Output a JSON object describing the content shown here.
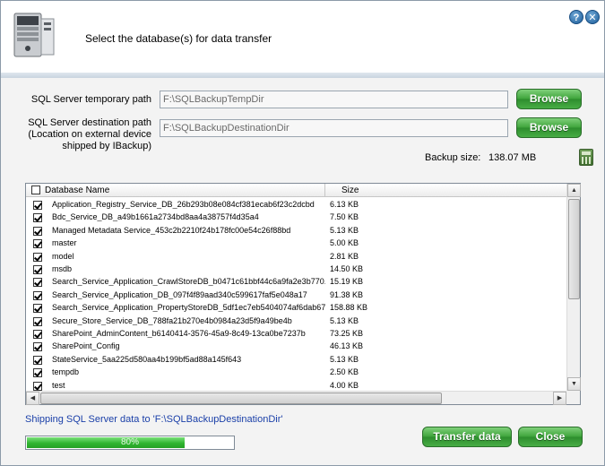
{
  "header": {
    "title": "Select the database(s) for data transfer",
    "help_label": "?",
    "close_label": "✕"
  },
  "paths": {
    "temp_label": "SQL Server temporary path",
    "temp_value": "F:\\SQLBackupTempDir",
    "dest_label_line1": "SQL Server destination path",
    "dest_label_line2": "(Location on external device",
    "dest_label_line3": "shipped by IBackup)",
    "dest_value": "F:\\SQLBackupDestinationDir",
    "browse_label": "Browse"
  },
  "backup": {
    "size_label": "Backup size:",
    "size_value": "138.07 MB"
  },
  "table": {
    "columns": {
      "name": "Database Name",
      "size": "Size"
    },
    "rows": [
      {
        "name": "Application_Registry_Service_DB_26b293b08e084cf381ecab6f23c2dcbd",
        "size": "6.13 KB",
        "checked": true
      },
      {
        "name": "Bdc_Service_DB_a49b1661a2734bd8aa4a38757f4d35a4",
        "size": "7.50 KB",
        "checked": true
      },
      {
        "name": "Managed Metadata Service_453c2b2210f24b178fc00e54c26f88bd",
        "size": "5.13 KB",
        "checked": true
      },
      {
        "name": "master",
        "size": "5.00 KB",
        "checked": true
      },
      {
        "name": "model",
        "size": "2.81 KB",
        "checked": true
      },
      {
        "name": "msdb",
        "size": "14.50 KB",
        "checked": true
      },
      {
        "name": "Search_Service_Application_CrawlStoreDB_b0471c61bbf44c6a9fa2e3b770...",
        "size": "15.19 KB",
        "checked": true
      },
      {
        "name": "Search_Service_Application_DB_097f4f89aad340c599617faf5e048a17",
        "size": "91.38 KB",
        "checked": true
      },
      {
        "name": "Search_Service_Application_PropertyStoreDB_5df1ec7eb5404074af6dab67...",
        "size": "158.88 KB",
        "checked": true
      },
      {
        "name": "Secure_Store_Service_DB_788fa21b270e4b0984a23d5f9a49be4b",
        "size": "5.13 KB",
        "checked": true
      },
      {
        "name": "SharePoint_AdminContent_b6140414-3576-45a9-8c49-13ca0be7237b",
        "size": "73.25 KB",
        "checked": true
      },
      {
        "name": "SharePoint_Config",
        "size": "46.13 KB",
        "checked": true
      },
      {
        "name": "StateService_5aa225d580aa4b199bf5ad88a145f643",
        "size": "5.13 KB",
        "checked": true
      },
      {
        "name": "tempdb",
        "size": "2.50 KB",
        "checked": true
      },
      {
        "name": "test",
        "size": "4.00 KB",
        "checked": true
      }
    ]
  },
  "status": {
    "text": "Shipping  SQL Server data to 'F:\\SQLBackupDestinationDir'",
    "progress_label": "80%",
    "progress_fraction": 0.8
  },
  "actions": {
    "transfer_label": "Transfer data",
    "close_label": "Close"
  },
  "colors": {
    "accent_green": "#3da33a",
    "status_blue": "#1a3fa8",
    "header_bg": "#ffffff",
    "dialog_bg": "#f3f3f3"
  },
  "icons": [
    "server-app-icon",
    "help-icon",
    "close-icon",
    "calculator-icon",
    "checkbox-icon",
    "scroll-up-icon",
    "scroll-down-icon",
    "scroll-left-icon",
    "scroll-right-icon"
  ]
}
